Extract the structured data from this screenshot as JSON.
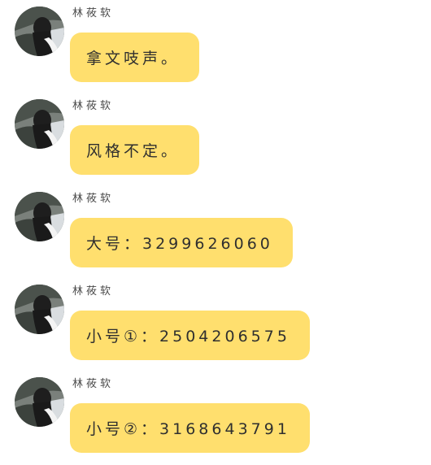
{
  "chat": {
    "messages": [
      {
        "sender": "林莜软",
        "text": "拿文吱声。"
      },
      {
        "sender": "林莜软",
        "text": "风格不定。"
      },
      {
        "sender": "林莜软",
        "text": "大号：3299626060"
      },
      {
        "sender": "林莜软",
        "text": "小号①：2504206575"
      },
      {
        "sender": "林莜软",
        "text": "小号②：3168643791"
      }
    ],
    "avatar": {
      "icon": "user-photo-avatar"
    },
    "colors": {
      "bubble": "#ffdf6e",
      "background": "#ffffff",
      "sender_text": "#4a4a4a",
      "message_text": "#2f2f2f"
    }
  }
}
